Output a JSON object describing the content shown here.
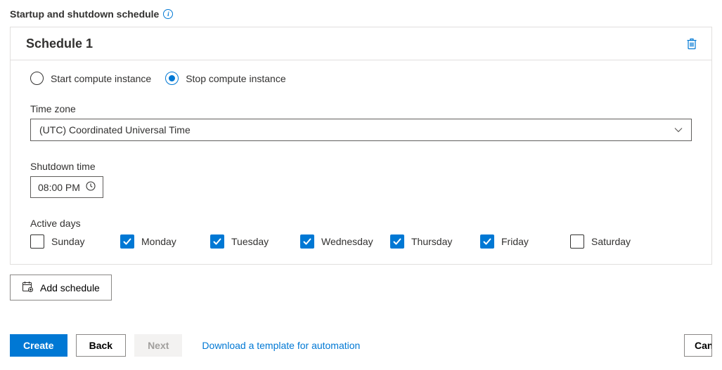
{
  "section_title": "Startup and shutdown schedule",
  "schedule": {
    "title": "Schedule 1",
    "radios": {
      "start": "Start compute instance",
      "stop": "Stop compute instance",
      "selected": "stop"
    },
    "timezone": {
      "label": "Time zone",
      "value": "(UTC) Coordinated Universal Time"
    },
    "shutdown": {
      "label": "Shutdown time",
      "value": "08:00 PM"
    },
    "active_days": {
      "label": "Active days",
      "days": [
        {
          "name": "Sunday",
          "checked": false
        },
        {
          "name": "Monday",
          "checked": true
        },
        {
          "name": "Tuesday",
          "checked": true
        },
        {
          "name": "Wednesday",
          "checked": true
        },
        {
          "name": "Thursday",
          "checked": true
        },
        {
          "name": "Friday",
          "checked": true
        },
        {
          "name": "Saturday",
          "checked": false
        }
      ]
    }
  },
  "add_schedule_label": "Add schedule",
  "footer": {
    "create": "Create",
    "back": "Back",
    "next": "Next",
    "download": "Download a template for automation",
    "cancel": "Cancel"
  }
}
